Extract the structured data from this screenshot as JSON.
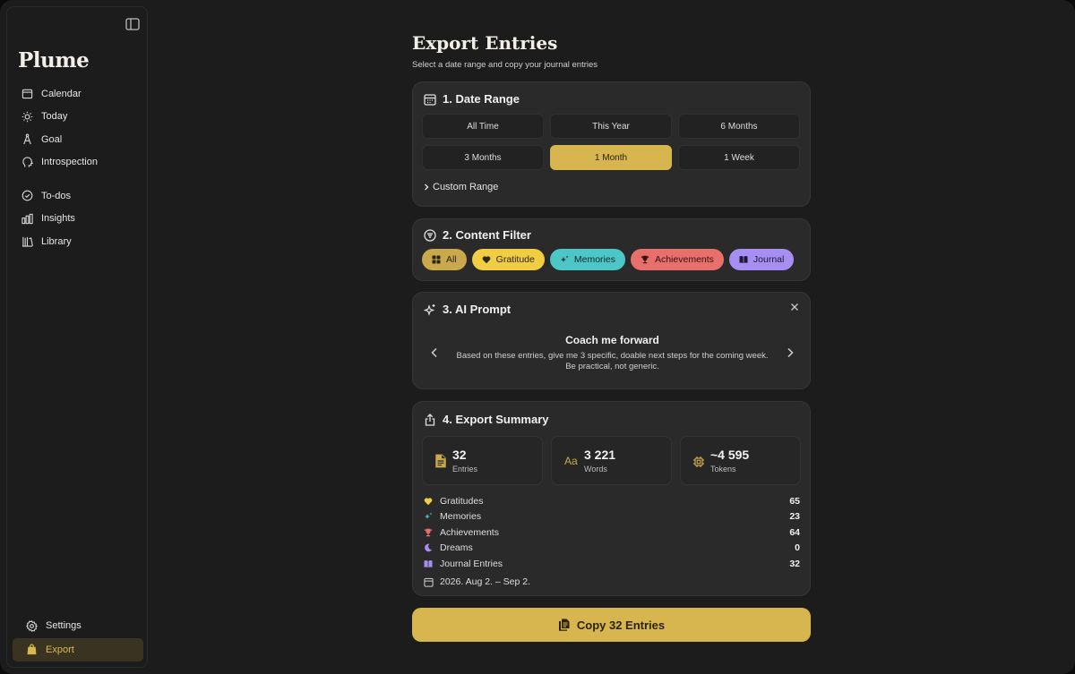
{
  "app": {
    "brand": "Plume"
  },
  "sidebar": {
    "items": [
      {
        "label": "Calendar",
        "icon": "calendar-icon"
      },
      {
        "label": "Today",
        "icon": "sun-icon"
      },
      {
        "label": "Goal",
        "icon": "compass-icon"
      },
      {
        "label": "Introspection",
        "icon": "brain-icon"
      },
      {
        "label": "To-dos",
        "icon": "check-circle-icon"
      },
      {
        "label": "Insights",
        "icon": "bar-chart-icon"
      },
      {
        "label": "Library",
        "icon": "library-icon"
      }
    ],
    "bottom": [
      {
        "label": "Settings",
        "icon": "gear-icon"
      },
      {
        "label": "Export",
        "icon": "export-bag-icon",
        "active": true
      }
    ]
  },
  "page": {
    "title": "Export Entries",
    "subtitle": "Select a date range and copy your journal entries"
  },
  "date_range": {
    "title": "1. Date Range",
    "options": [
      "All Time",
      "This Year",
      "6 Months",
      "3 Months",
      "1 Month",
      "1 Week"
    ],
    "selected": "1 Month",
    "custom_label": "Custom Range"
  },
  "content_filter": {
    "title": "2. Content Filter",
    "chips": [
      "All",
      "Gratitude",
      "Memories",
      "Achievements",
      "Journal"
    ]
  },
  "ai_prompt": {
    "title": "3. AI Prompt",
    "prompt_title": "Coach me forward",
    "prompt_text": "Based on these entries, give me 3 specific, doable next steps for the coming week. Be practical, not generic."
  },
  "summary": {
    "title": "4. Export Summary",
    "stats": [
      {
        "value": "32",
        "label": "Entries"
      },
      {
        "value": "3 221",
        "label": "Words"
      },
      {
        "value": "~4 595",
        "label": "Tokens"
      }
    ],
    "breakdown": [
      {
        "label": "Gratitudes",
        "value": "65"
      },
      {
        "label": "Memories",
        "value": "23"
      },
      {
        "label": "Achievements",
        "value": "64"
      },
      {
        "label": "Dreams",
        "value": "0"
      },
      {
        "label": "Journal Entries",
        "value": "32"
      }
    ],
    "date_range_text": "2026. Aug 2. – Sep 2."
  },
  "copy_button": {
    "label": "Copy 32 Entries"
  },
  "colors": {
    "accent": "#d8b64f",
    "gratitude": "#f0cd43",
    "memories": "#4cc6c6",
    "achievements": "#e8706c",
    "journal": "#a78ef2"
  }
}
